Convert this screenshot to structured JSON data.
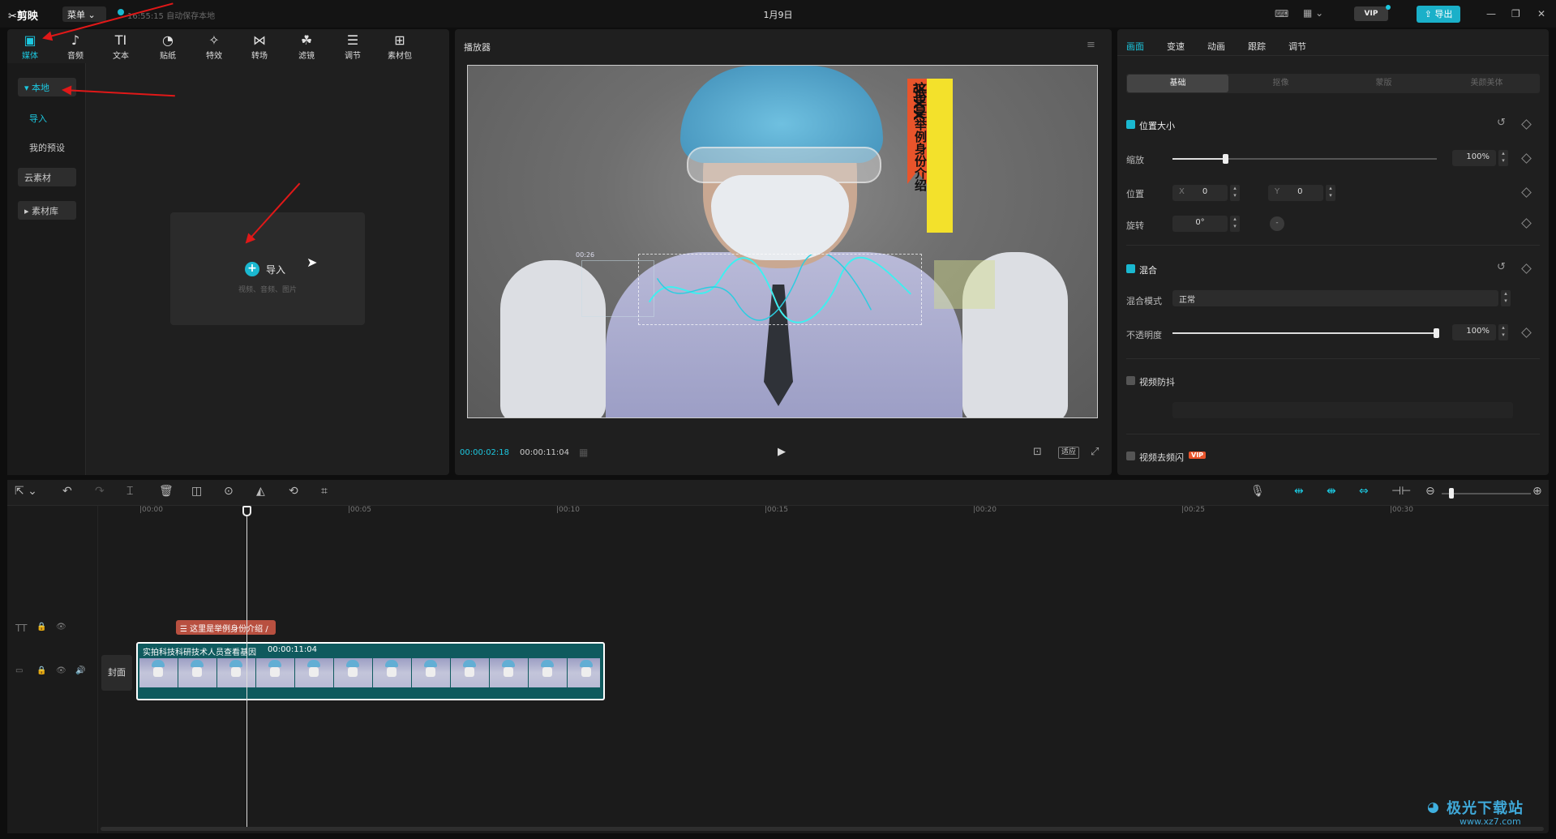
{
  "app": {
    "logo": "剪映",
    "menu_label": "菜单 ⌄",
    "autosave": "16:55:15 自动保存本地",
    "doc_title": "1月9日",
    "vip_label": "VIP",
    "export_label": "导出"
  },
  "media_tabs": [
    {
      "label": "媒体",
      "icon": "media-icon",
      "glyph": "▣"
    },
    {
      "label": "音频",
      "icon": "audio-icon",
      "glyph": "♪"
    },
    {
      "label": "文本",
      "icon": "text-icon",
      "glyph": "TI"
    },
    {
      "label": "贴纸",
      "icon": "sticker-icon",
      "glyph": "◔"
    },
    {
      "label": "特效",
      "icon": "effects-icon",
      "glyph": "✧"
    },
    {
      "label": "转场",
      "icon": "transition-icon",
      "glyph": "⋈"
    },
    {
      "label": "滤镜",
      "icon": "filter-icon",
      "glyph": "☘"
    },
    {
      "label": "调节",
      "icon": "adjust-icon",
      "glyph": "☰"
    },
    {
      "label": "素材包",
      "icon": "package-icon",
      "glyph": "⊞"
    }
  ],
  "sidebar": {
    "local": "▾ 本地",
    "import": "导入",
    "my_presets": "我的预设",
    "cloud": "云素材",
    "library": "▸ 素材库"
  },
  "import_card": {
    "label": "导入",
    "hint": "视频、音频、图片"
  },
  "player": {
    "title": "播放器",
    "current_time": "00:00:02:18",
    "total_time": "00:00:11:04",
    "ratio_label": "适应",
    "overlay_red": "张XX",
    "overlay_yellow": "这里是举例身份介绍",
    "holo_time": "00:26"
  },
  "inspector": {
    "tabs": [
      "画面",
      "变速",
      "动画",
      "跟踪",
      "调节"
    ],
    "subtabs": [
      "基础",
      "抠像",
      "蒙版",
      "美颜美体"
    ],
    "position_size": "位置大小",
    "scale_label": "缩放",
    "scale_value": "100%",
    "scale_fraction": 0.2,
    "position_label": "位置",
    "pos_x_label": "X",
    "pos_x": "0",
    "pos_y_label": "Y",
    "pos_y": "0",
    "rotate_label": "旋转",
    "rotate_value": "0°",
    "blend_section": "混合",
    "blend_mode_label": "混合模式",
    "blend_mode_value": "正常",
    "opacity_label": "不透明度",
    "opacity_value": "100%",
    "opacity_fraction": 1.0,
    "stabilize": "视频防抖",
    "deflicker": "视频去频闪",
    "deflicker_badge": "VIP"
  },
  "timeline": {
    "ruler": [
      "|00:00",
      "|00:05",
      "|00:10",
      "|00:15",
      "|00:20",
      "|00:25",
      "|00:30"
    ],
    "text_clip": "☰ 这里是举例身份介绍 /",
    "cover_label": "封面",
    "video_clip_title": "实拍科技科研技术人员查看基因",
    "video_clip_duration": "00:00:11:04"
  },
  "colors": {
    "accent": "#1cc8e0",
    "arrow": "#e01818",
    "clip_teal": "#0f5a5e",
    "text_clip": "#b85040"
  }
}
